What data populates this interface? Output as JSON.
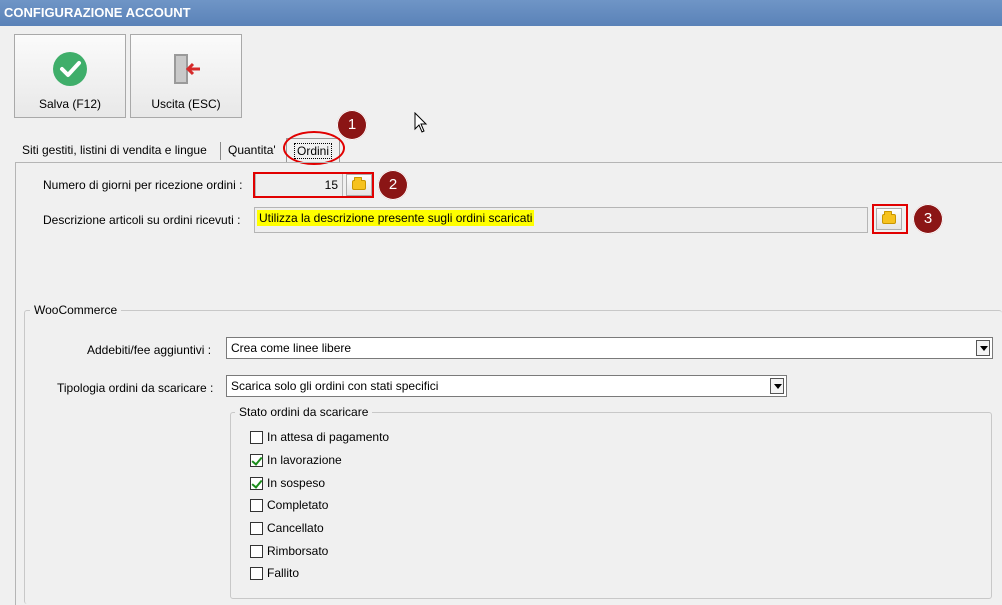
{
  "window": {
    "title": "CONFIGURAZIONE ACCOUNT"
  },
  "toolbar": {
    "save_label": "Salva (F12)",
    "exit_label": "Uscita (ESC)"
  },
  "tabs": [
    {
      "label": "Siti gestiti, listini di vendita e lingue",
      "active": false
    },
    {
      "label": "Quantita'",
      "active": false
    },
    {
      "label": "Ordini",
      "active": true
    }
  ],
  "orders": {
    "days_label": "Numero di giorni per ricezione ordini :",
    "days_value": "15",
    "description_label": "Descrizione articoli su ordini ricevuti :",
    "description_value": "Utilizza la descrizione presente sugli ordini scaricati"
  },
  "woocommerce": {
    "group_title": "WooCommerce",
    "fees_label": "Addebiti/fee aggiuntivi :",
    "fees_value": "Crea come linee libere",
    "order_type_label": "Tipologia ordini da scaricare :",
    "order_type_value": "Scarica solo gli ordini con stati specifici",
    "status_group_title": "Stato ordini da scaricare",
    "statuses": [
      {
        "label": "In attesa di pagamento",
        "checked": false
      },
      {
        "label": "In lavorazione",
        "checked": true
      },
      {
        "label": "In sospeso",
        "checked": true
      },
      {
        "label": "Completato",
        "checked": false
      },
      {
        "label": "Cancellato",
        "checked": false
      },
      {
        "label": "Rimborsato",
        "checked": false
      },
      {
        "label": "Fallito",
        "checked": false
      }
    ]
  },
  "annotations": {
    "badge1": "1",
    "badge2": "2",
    "badge3": "3"
  },
  "colors": {
    "title_bar": "#5a82b8",
    "highlight": "#ffff00",
    "annotation_red": "#e10000",
    "badge": "#8b1515"
  }
}
